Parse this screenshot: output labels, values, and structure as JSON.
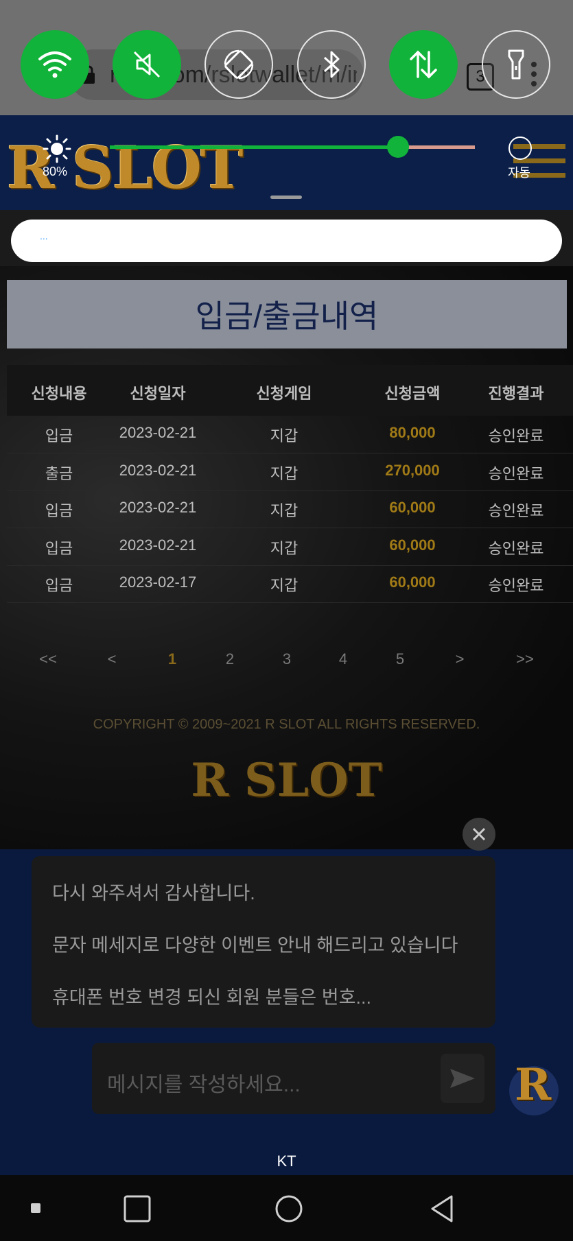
{
  "browser": {
    "url_text": "rslot.com/rslotwallet/m/ind",
    "tab_count": "3"
  },
  "quick_settings": [
    {
      "name": "wifi-toggle",
      "icon": "wifi-icon",
      "state": "on"
    },
    {
      "name": "sound-toggle",
      "icon": "mute-icon",
      "state": "on"
    },
    {
      "name": "rotate-toggle",
      "icon": "auto-rotate-icon",
      "state": "off"
    },
    {
      "name": "bluetooth-toggle",
      "icon": "bluetooth-icon",
      "state": "off"
    },
    {
      "name": "data-toggle",
      "icon": "mobile-data-icon",
      "state": "on"
    },
    {
      "name": "flashlight-toggle",
      "icon": "flashlight-icon",
      "state": "off"
    }
  ],
  "brightness": {
    "value_label": "80%",
    "level": 0.79,
    "auto_label": "자동"
  },
  "header": {
    "logo": "R SLOT"
  },
  "notice": {
    "text": "..."
  },
  "page": {
    "title": "입금/출금내역"
  },
  "table": {
    "headers": [
      "신청내용",
      "신청일자",
      "신청게임",
      "신청금액",
      "진행결과"
    ],
    "rows": [
      [
        "입금",
        "2023-02-21",
        "지갑",
        "80,000",
        "승인완료"
      ],
      [
        "출금",
        "2023-02-21",
        "지갑",
        "270,000",
        "승인완료"
      ],
      [
        "입금",
        "2023-02-21",
        "지갑",
        "60,000",
        "승인완료"
      ],
      [
        "입금",
        "2023-02-21",
        "지갑",
        "60,000",
        "승인완료"
      ],
      [
        "입금",
        "2023-02-17",
        "지갑",
        "60,000",
        "승인완료"
      ]
    ]
  },
  "pagination": [
    "<<",
    "<",
    "1",
    "2",
    "3",
    "4",
    "5",
    ">",
    ">>"
  ],
  "footer": {
    "copyright": "COPYRIGHT © 2009~2021 R SLOT ALL RIGHTS RESERVED.",
    "logo": "R SLOT"
  },
  "chat": {
    "messages": [
      "다시 와주셔서 감사합니다.",
      "문자 메세지로 다양한 이벤트 안내 해드리고 있습니다",
      "휴대폰 번호 변경 되신 회원 분들은 번호..."
    ],
    "placeholder": "메시지를 작성하세요...",
    "avatar": "R"
  },
  "status": {
    "carrier": "KT"
  },
  "colors": {
    "toggle_on": "#12b33a",
    "accent_gold": "#a07a16",
    "header_bg": "#0b1f49"
  }
}
